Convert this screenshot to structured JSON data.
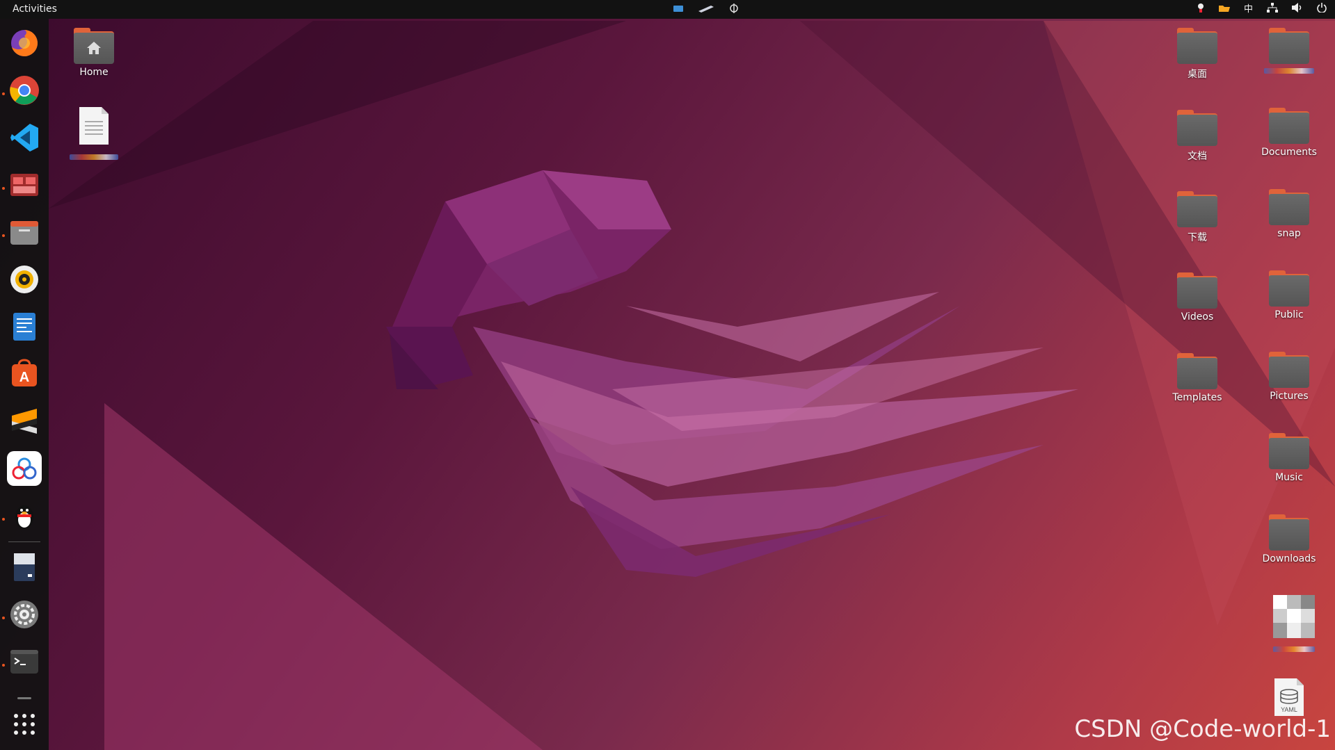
{
  "topbar": {
    "activities_label": "Activities",
    "input_method_label": "中"
  },
  "dock": {
    "apps": [
      {
        "name": "firefox",
        "icon": "firefox-icon"
      },
      {
        "name": "chrome",
        "icon": "chrome-icon"
      },
      {
        "name": "vscode",
        "icon": "vscode-icon"
      },
      {
        "name": "remote-desktop",
        "icon": "remote-desktop-icon"
      },
      {
        "name": "files",
        "icon": "folder-icon"
      },
      {
        "name": "rhythmbox",
        "icon": "speaker-icon"
      },
      {
        "name": "libreoffice-writer",
        "icon": "document-icon"
      },
      {
        "name": "ubuntu-software",
        "icon": "store-icon"
      },
      {
        "name": "sublime-text",
        "icon": "sublime-icon"
      },
      {
        "name": "baidu-netdisk",
        "icon": "cloud-icon"
      },
      {
        "name": "qq",
        "icon": "penguin-icon"
      },
      {
        "name": "disk-image",
        "icon": "disk-icon"
      },
      {
        "name": "settings",
        "icon": "gear-icon"
      },
      {
        "name": "terminal",
        "icon": "terminal-icon"
      },
      {
        "name": "show-apps",
        "icon": "grid-icon"
      }
    ],
    "accent": "#e95420"
  },
  "desktop": {
    "left_icons": [
      {
        "label": "Home",
        "icon": "home-folder-icon"
      },
      {
        "label": "",
        "icon": "text-file-icon"
      }
    ],
    "right_col1": [
      {
        "label": "桌面"
      },
      {
        "label": "文档"
      },
      {
        "label": "下载"
      },
      {
        "label": "Videos"
      },
      {
        "label": "Templates"
      }
    ],
    "right_col2": [
      {
        "label": ""
      },
      {
        "label": "Documents"
      },
      {
        "label": "snap"
      },
      {
        "label": "Public"
      },
      {
        "label": "Pictures"
      },
      {
        "label": "Music"
      },
      {
        "label": "Downloads"
      }
    ],
    "yaml_label": "YAML"
  },
  "watermark": "CSDN @Code-world-1"
}
